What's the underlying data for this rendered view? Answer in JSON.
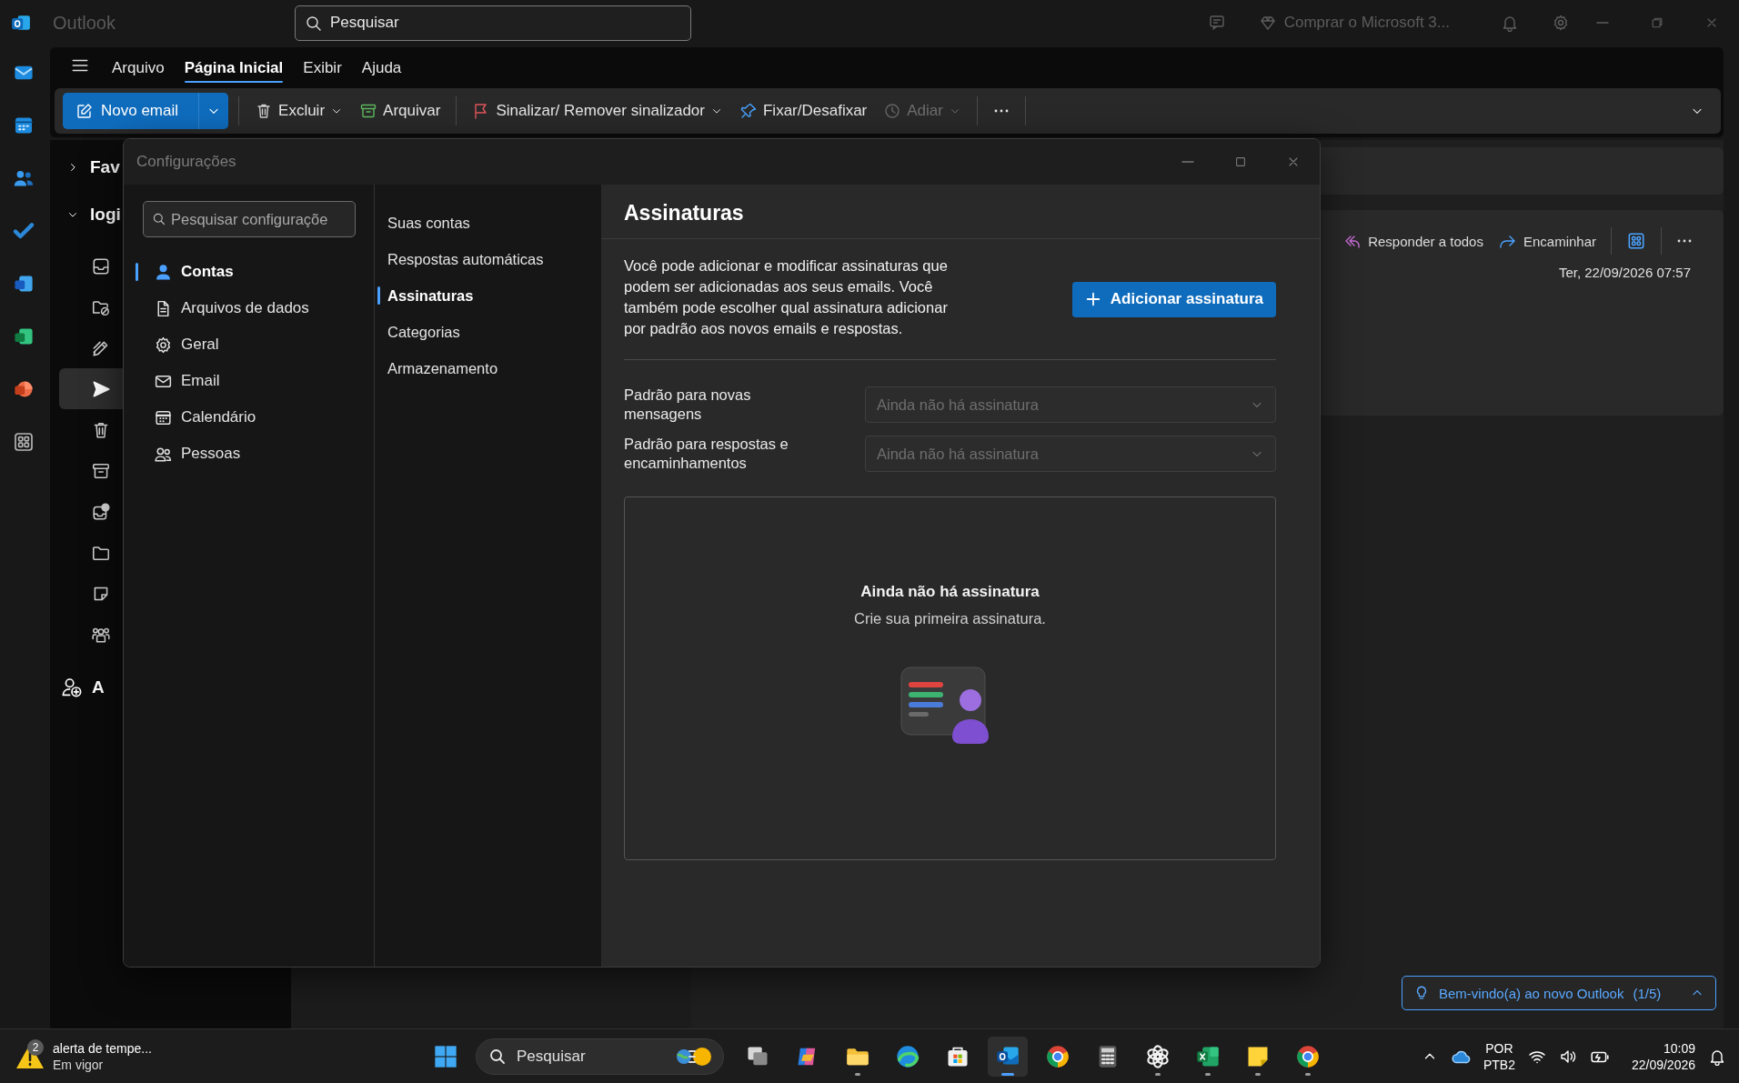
{
  "title_bar": {
    "app_name": "Outlook",
    "search_placeholder": "Pesquisar",
    "buy_link": "Comprar o Microsoft 3..."
  },
  "rail": [
    {
      "kind": "mail"
    },
    {
      "kind": "calendar"
    },
    {
      "kind": "people"
    },
    {
      "kind": "todo"
    },
    {
      "kind": "word"
    },
    {
      "kind": "excel"
    },
    {
      "kind": "powerpoint"
    },
    {
      "kind": "apps"
    }
  ],
  "ribbon": {
    "tabs": [
      {
        "label": "Arquivo",
        "selected": false
      },
      {
        "label": "Página Inicial",
        "selected": true
      },
      {
        "label": "Exibir",
        "selected": false
      },
      {
        "label": "Ajuda",
        "selected": false
      }
    ],
    "toolbar": [
      {
        "kind": "new-email",
        "label": "Novo email",
        "caret": true,
        "disabled": false
      },
      {
        "kind": "separator"
      },
      {
        "kind": "delete",
        "label": "Excluir",
        "caret": true,
        "disabled": false
      },
      {
        "kind": "archive",
        "label": "Arquivar",
        "caret": false,
        "disabled": false
      },
      {
        "kind": "separator"
      },
      {
        "kind": "flag",
        "label": "Sinalizar/ Remover sinalizador",
        "caret": true,
        "disabled": false
      },
      {
        "kind": "pin",
        "label": "Fixar/Desafixar",
        "caret": false,
        "disabled": false
      },
      {
        "kind": "snooze",
        "label": "Adiar",
        "caret": true,
        "disabled": true
      },
      {
        "kind": "separator"
      },
      {
        "kind": "more"
      },
      {
        "kind": "separator"
      },
      {
        "kind": "expand"
      }
    ]
  },
  "folder_pane": {
    "sections": [
      {
        "label": "Fav",
        "expanded": false
      },
      {
        "label": "logi",
        "expanded": true,
        "folders": [
          {
            "kind": "inbox",
            "selected": false
          },
          {
            "kind": "junk",
            "selected": false
          },
          {
            "kind": "drafts",
            "selected": false
          },
          {
            "kind": "sent",
            "selected": true
          },
          {
            "kind": "deleted",
            "selected": false
          },
          {
            "kind": "archive",
            "selected": false
          },
          {
            "kind": "outbox",
            "selected": false
          },
          {
            "kind": "folder",
            "selected": false
          },
          {
            "kind": "notes",
            "selected": false
          },
          {
            "kind": "groups",
            "selected": false
          }
        ]
      }
    ],
    "add_account": "A"
  },
  "reading_pane": {
    "actions": [
      {
        "kind": "reply-all",
        "label": "Responder a todos"
      },
      {
        "kind": "forward",
        "label": "Encaminhar"
      },
      {
        "kind": "separator"
      },
      {
        "kind": "apps"
      },
      {
        "kind": "separator"
      },
      {
        "kind": "more"
      }
    ],
    "date": "Ter, 22/09/2026 07:57"
  },
  "tip": {
    "text": "Bem-vindo(a) ao novo Outlook",
    "counter": "(1/5)"
  },
  "settings": {
    "title": "Configurações",
    "search_placeholder": "Pesquisar configuraçõe",
    "categories": [
      {
        "kind": "accounts",
        "label": "Contas",
        "selected": true
      },
      {
        "kind": "data-files",
        "label": "Arquivos de dados",
        "selected": false
      },
      {
        "kind": "general",
        "label": "Geral",
        "selected": false
      },
      {
        "kind": "email",
        "label": "Email",
        "selected": false
      },
      {
        "kind": "calendar",
        "label": "Calendário",
        "selected": false
      },
      {
        "kind": "people",
        "label": "Pessoas",
        "selected": false
      }
    ],
    "subcategories": [
      {
        "label": "Suas contas",
        "selected": false
      },
      {
        "label": "Respostas automáticas",
        "selected": false
      },
      {
        "label": "Assinaturas",
        "selected": true
      },
      {
        "label": "Categorias",
        "selected": false
      },
      {
        "label": "Armazenamento",
        "selected": false
      }
    ],
    "page": {
      "heading": "Assinaturas",
      "description": "Você pode adicionar e modificar assinaturas que podem ser adicionadas aos seus emails. Você também pode escolher qual assinatura adicionar por padrão aos novos emails e respostas.",
      "add_button": "Adicionar assinatura",
      "defaults": [
        {
          "label": "Padrão para novas mensagens",
          "value": "Ainda não há assinatura",
          "disabled": true
        },
        {
          "label": "Padrão para respostas e encaminhamentos",
          "value": "Ainda não há assinatura",
          "disabled": true
        }
      ],
      "empty_state": {
        "title": "Ainda não há assinatura",
        "text": "Crie sua primeira assinatura."
      }
    }
  },
  "taskbar": {
    "weather": {
      "badge": "2",
      "title": "alerta de tempe...",
      "subtitle": "Em vigor"
    },
    "search_placeholder": "Pesquisar",
    "apps": [
      {
        "kind": "task-view",
        "running": false,
        "selected": false
      },
      {
        "kind": "copilot",
        "running": false,
        "selected": false
      },
      {
        "kind": "explorer",
        "running": true,
        "selected": false
      },
      {
        "kind": "edge",
        "running": false,
        "selected": false
      },
      {
        "kind": "store",
        "running": false,
        "selected": false
      },
      {
        "kind": "outlook",
        "running": true,
        "selected": true
      },
      {
        "kind": "chrome",
        "running": false,
        "selected": false
      },
      {
        "kind": "calculator",
        "running": false,
        "selected": false
      },
      {
        "kind": "chatgpt",
        "running": true,
        "selected": false
      },
      {
        "kind": "excel",
        "running": true,
        "selected": false
      },
      {
        "kind": "sticky-notes",
        "running": true,
        "selected": false
      },
      {
        "kind": "chrome",
        "running": true,
        "selected": false
      }
    ],
    "language": "POR",
    "keyboard": "PTB2",
    "time": "10:09",
    "date": "22/09/2026"
  }
}
